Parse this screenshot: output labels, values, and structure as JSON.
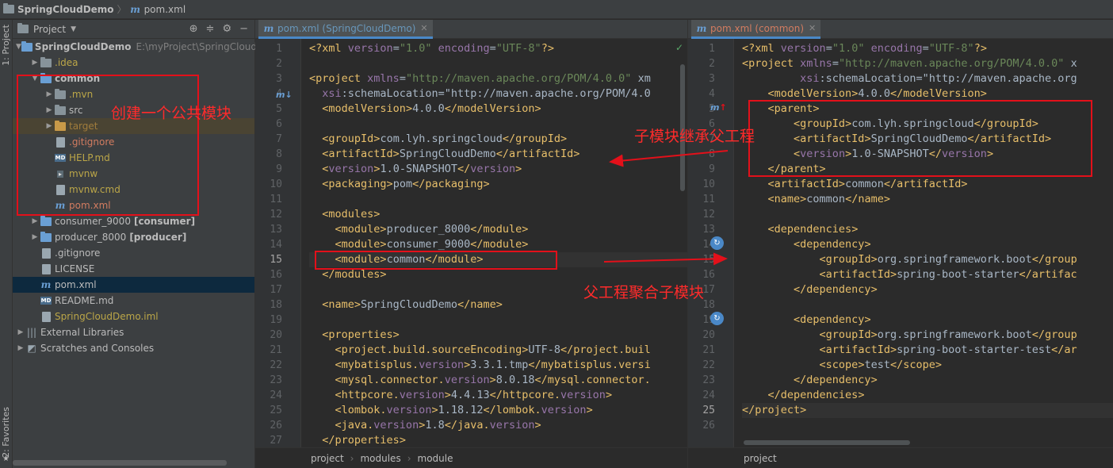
{
  "breadcrumb": {
    "project": "SpringCloudDemo",
    "file": "pom.xml"
  },
  "sidebar": {
    "project_tab": "1: Project",
    "favorites_tab": "2: Favorites"
  },
  "project_panel": {
    "view_label": "Project",
    "tree": [
      {
        "label": "SpringCloudDemo",
        "extra": "E:\\myProject\\SpringCloud"
      },
      {
        "label": ".idea"
      },
      {
        "label": "common"
      },
      {
        "label": ".mvn"
      },
      {
        "label": "src"
      },
      {
        "label": "target"
      },
      {
        "label": ".gitignore"
      },
      {
        "label": "HELP.md"
      },
      {
        "label": "mvnw"
      },
      {
        "label": "mvnw.cmd"
      },
      {
        "label": "pom.xml"
      },
      {
        "label": "consumer_9000",
        "extra": "[consumer]"
      },
      {
        "label": "producer_8000",
        "extra": "[producer]"
      },
      {
        "label": ".gitignore"
      },
      {
        "label": "LICENSE"
      },
      {
        "label": "pom.xml"
      },
      {
        "label": "README.md"
      },
      {
        "label": "SpringCloudDemo.iml"
      },
      {
        "label": "External Libraries"
      },
      {
        "label": "Scratches and Consoles"
      }
    ]
  },
  "left_editor": {
    "tab": "pom.xml (SpringCloudDemo)",
    "breadcrumb": [
      "project",
      "modules",
      "module"
    ],
    "line_numbers": [
      "1",
      "2",
      "3",
      "4",
      "5",
      "6",
      "7",
      "8",
      "9",
      "10",
      "11",
      "12",
      "13",
      "14",
      "15",
      "16",
      "17",
      "18",
      "19",
      "20",
      "21",
      "22",
      "23",
      "24",
      "25",
      "26",
      "27"
    ],
    "lines": [
      "<?xml version=\"1.0\" encoding=\"UTF-8\"?>",
      "",
      "<project xmlns=\"http://maven.apache.org/POM/4.0.0\" xm",
      "  xsi:schemaLocation=\"http://maven.apache.org/POM/4.0",
      "  <modelVersion>4.0.0</modelVersion>",
      "",
      "  <groupId>com.lyh.springcloud</groupId>",
      "  <artifactId>SpringCloudDemo</artifactId>",
      "  <version>1.0-SNAPSHOT</version>",
      "  <packaging>pom</packaging>",
      "",
      "  <modules>",
      "    <module>producer_8000</module>",
      "    <module>consumer_9000</module>",
      "    <module>common</module>",
      "  </modules>",
      "",
      "  <name>SpringCloudDemo</name>",
      "",
      "  <properties>",
      "    <project.build.sourceEncoding>UTF-8</project.buil",
      "    <mybatisplus.version>3.3.1.tmp</mybatisplus.versi",
      "    <mysql.connector.version>8.0.18</mysql.connector.",
      "    <httpcore.version>4.4.13</httpcore.version>",
      "    <lombok.version>1.18.12</lombok.version>",
      "    <java.version>1.8</java.version>",
      "  </properties>"
    ]
  },
  "right_editor": {
    "tab": "pom.xml (common)",
    "breadcrumb": [
      "project"
    ],
    "line_numbers": [
      "1",
      "2",
      "3",
      "4",
      "5",
      "6",
      "7",
      "8",
      "9",
      "10",
      "11",
      "12",
      "13",
      "14",
      "15",
      "16",
      "17",
      "18",
      "19",
      "20",
      "21",
      "22",
      "23",
      "24",
      "25",
      "26"
    ],
    "lines": [
      "<?xml version=\"1.0\" encoding=\"UTF-8\"?>",
      "<project xmlns=\"http://maven.apache.org/POM/4.0.0\" x",
      "         xsi:schemaLocation=\"http://maven.apache.org",
      "    <modelVersion>4.0.0</modelVersion>",
      "    <parent>",
      "        <groupId>com.lyh.springcloud</groupId>",
      "        <artifactId>SpringCloudDemo</artifactId>",
      "        <version>1.0-SNAPSHOT</version>",
      "    </parent>",
      "    <artifactId>common</artifactId>",
      "    <name>common</name>",
      "",
      "    <dependencies>",
      "        <dependency>",
      "            <groupId>org.springframework.boot</group",
      "            <artifactId>spring-boot-starter</artifac",
      "        </dependency>",
      "",
      "        <dependency>",
      "            <groupId>org.springframework.boot</group",
      "            <artifactId>spring-boot-starter-test</ar",
      "            <scope>test</scope>",
      "        </dependency>",
      "    </dependencies>",
      "</project>",
      ""
    ]
  },
  "annotations": {
    "create_common": "创建一个公共模块",
    "inherit_parent": "子模块继承父工程",
    "aggregate_modules": "父工程聚合子模块"
  },
  "colors": {
    "annotation": "#e3101a",
    "tag": "#e8bf6a",
    "value": "#6a8759",
    "accent": "#4a88c7"
  }
}
